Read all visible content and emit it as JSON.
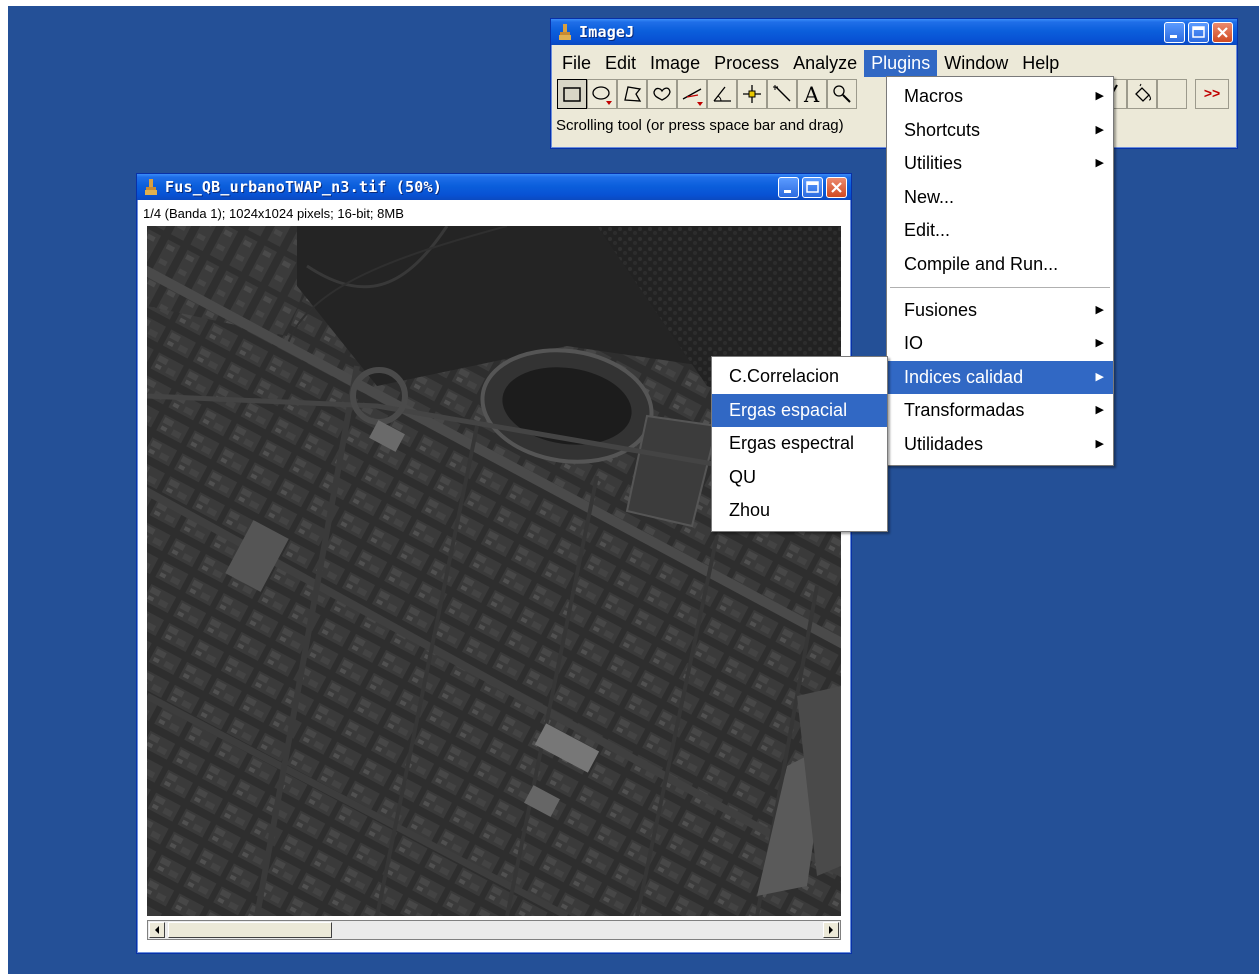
{
  "main_window": {
    "title": "ImageJ",
    "menus": [
      "File",
      "Edit",
      "Image",
      "Process",
      "Analyze",
      "Plugins",
      "Window",
      "Help"
    ],
    "active_menu": "Plugins",
    "status_text": "Scrolling tool (or press space bar and drag)",
    "toolbar_more": ">>"
  },
  "image_window": {
    "title": "Fus_QB_urbanoTWAP_n3.tif (50%)",
    "info": "1/4 (Banda 1); 1024x1024 pixels; 16-bit; 8MB"
  },
  "plugins_menu": {
    "items": [
      "Macros",
      "Shortcuts",
      "Utilities",
      "New...",
      "Edit...",
      "Compile and Run...",
      "Fusiones",
      "IO",
      "Indices calidad",
      "Transformadas",
      "Utilidades"
    ],
    "highlighted": "Indices calidad"
  },
  "indices_menu": {
    "items": [
      "C.Correlacion",
      "Ergas espacial",
      "Ergas espectral",
      "QU",
      "Zhou"
    ],
    "highlighted": "Ergas espacial"
  },
  "colors": {
    "desktop": "#245097",
    "menu_highlight": "#3168c4",
    "title_bar": "#0b5fdc"
  }
}
